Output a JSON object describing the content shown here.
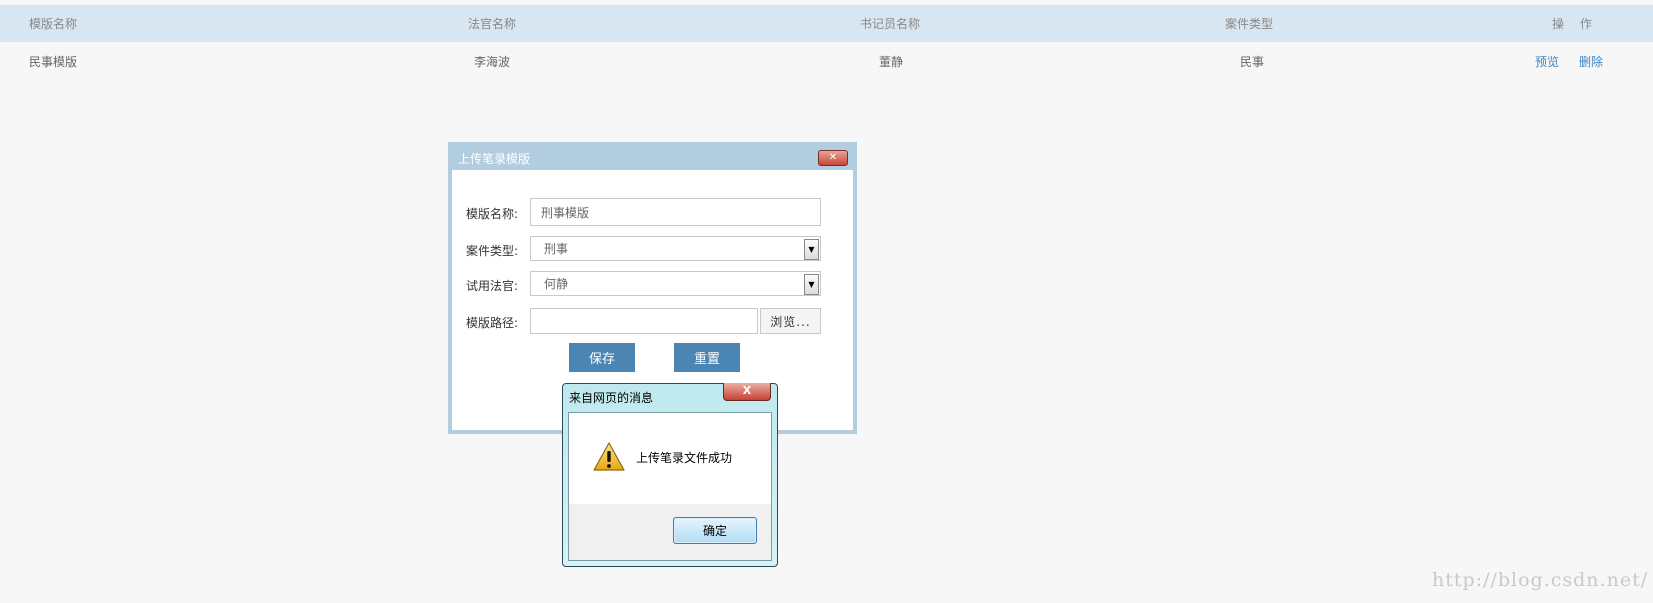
{
  "table": {
    "headers": [
      "模版名称",
      "法官名称",
      "书记员名称",
      "案件类型",
      "操 作"
    ],
    "rows": [
      {
        "template_name": "民事模版",
        "judge": "李海波",
        "clerk": "董静",
        "case_type": "民事",
        "preview": "预览",
        "delete": "删除"
      }
    ]
  },
  "upload_dialog": {
    "title": "上传笔录模版",
    "close": "✕",
    "template_name_label": "模版名称:",
    "template_name_value": "刑事模版",
    "case_type_label": "案件类型:",
    "case_type_value": "刑事",
    "judge_label": "试用法官:",
    "judge_value": "何静",
    "path_label": "模版路径:",
    "browse_label": "浏览...",
    "save_label": "保存",
    "reset_label": "重置"
  },
  "alert": {
    "title": "来自网页的消息",
    "close": "X",
    "message": "上传笔录文件成功",
    "ok_label": "确定",
    "icon": "warning-icon"
  },
  "watermark": "http://blog.csdn.net/",
  "colors": {
    "header_bg": "#d8e6f1",
    "link": "#3a86c7",
    "button_blue": "#4a85b4",
    "dialog_frame": "#b3cde0"
  }
}
